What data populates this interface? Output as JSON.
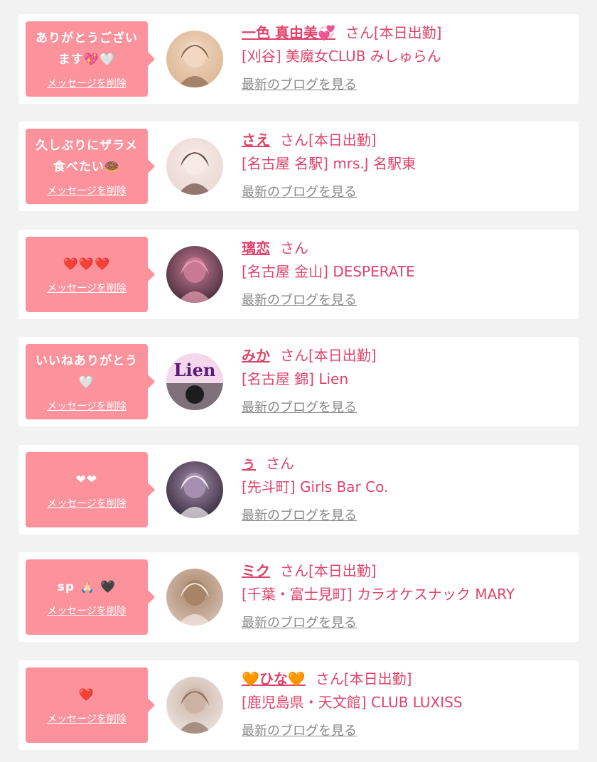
{
  "items": [
    {
      "message": "ありがとうござい\nます💖🤍",
      "delete_label": "メッセージを削除",
      "name": "一色 真由美💞",
      "suffix": "さん[本日出勤]",
      "shop": "[刈谷] 美魔女CLUB みしゅらん",
      "blog_label": "最新のブログを見る",
      "avatar_colors": [
        "#d9b48f",
        "#f2d7c3",
        "#8a6a52"
      ]
    },
    {
      "message": "久しぶりにザラメ\n食べたい🍩",
      "delete_label": "メッセージを削除",
      "name": "さえ",
      "suffix": "さん[本日出勤]",
      "shop": "[名古屋 名駅] mrs.J 名駅東",
      "blog_label": "最新のブログを見る",
      "avatar_colors": [
        "#e9d7d2",
        "#f7ebe6",
        "#6d4c45"
      ]
    },
    {
      "message": "❤️❤️❤️",
      "delete_label": "メッセージを削除",
      "name": "璃恋",
      "suffix": "さん",
      "shop": "[名古屋 金山] DESPERATE",
      "blog_label": "最新のブログを見る",
      "avatar_colors": [
        "#3a2630",
        "#c87a94",
        "#e8a0b4"
      ]
    },
    {
      "message": "いいねありがとう\n🤍",
      "delete_label": "メッセージを削除",
      "name": "みか",
      "suffix": "さん[本日出勤]",
      "shop": "[名古屋 錦] Lien",
      "blog_label": "最新のブログを見る",
      "avatar_colors": [
        "#f3d7ea",
        "#5a1b7a",
        "#1d1d1d"
      ],
      "avatar_text": "Lien"
    },
    {
      "message": "❤︎❤︎",
      "delete_label": "メッセージを削除",
      "name": "ぅ",
      "suffix": "さん",
      "shop": "[先斗町] Girls Bar Co.",
      "blog_label": "最新のブログを見る",
      "avatar_colors": [
        "#2c2230",
        "#a78fb0",
        "#f2eef2"
      ]
    },
    {
      "message": "sp 🙏🏻 🖤",
      "delete_label": "メッセージを削除",
      "name": "ミク",
      "suffix": "さん[本日出勤]",
      "shop": "[千葉・富士見町] カラオケスナック MARY",
      "blog_label": "最新のブログを見る",
      "avatar_colors": [
        "#d8c3b8",
        "#a88466",
        "#f3e7e1"
      ]
    },
    {
      "message": "❤️",
      "delete_label": "メッセージを削除",
      "name": "🧡ひな🧡",
      "suffix": "さん[本日出勤]",
      "shop": "[鹿児島県・天文館] CLUB LUXISS",
      "blog_label": "最新のブログを見る",
      "avatar_colors": [
        "#ece7e4",
        "#cdb3a4",
        "#8d6f5f"
      ]
    }
  ]
}
